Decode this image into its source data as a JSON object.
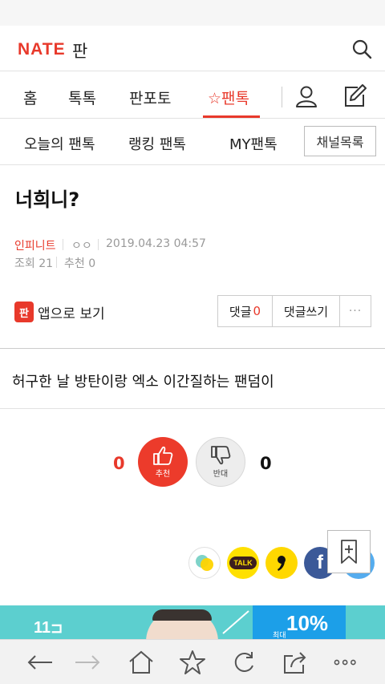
{
  "header": {
    "logo": "NATE",
    "logo_sub": "판"
  },
  "nav": {
    "items": [
      "홈",
      "톡톡",
      "판포토",
      "팬톡"
    ],
    "active_index": 3,
    "active_prefix": "☆"
  },
  "subnav": {
    "items": [
      "오늘의 팬톡",
      "랭킹 팬톡",
      "MY팬톡"
    ],
    "channel_button": "채널목록"
  },
  "article": {
    "title": "너희니?",
    "author": "인피니트",
    "nickname": "ㅇㅇ",
    "datetime": "2019.04.23 04:57",
    "views_label": "조회",
    "views": "21",
    "recommend_label": "추천",
    "recommend": "0",
    "app_icon_text": "판",
    "app_view_label": "앱으로 보기",
    "comment_label": "댓글",
    "comment_count": "0",
    "write_comment_label": "댓글쓰기",
    "more": "···",
    "body": "허구한 날 방탄이랑 엑소 이간질하는 팬덤이"
  },
  "votes": {
    "up_count": "0",
    "up_label": "추천",
    "down_count": "0",
    "down_label": "반대"
  },
  "share": {
    "talk_label": "TALK",
    "fb_label": "f"
  },
  "ad": {
    "brand": "11",
    "max_label": "최대",
    "percent": "10%"
  },
  "colors": {
    "accent": "#e8392b",
    "ad_teal": "#5ccfcf",
    "ad_blue": "#1c9fe8",
    "kakao_yellow": "#ffe000",
    "facebook": "#3b5998",
    "twitter": "#55acee"
  }
}
